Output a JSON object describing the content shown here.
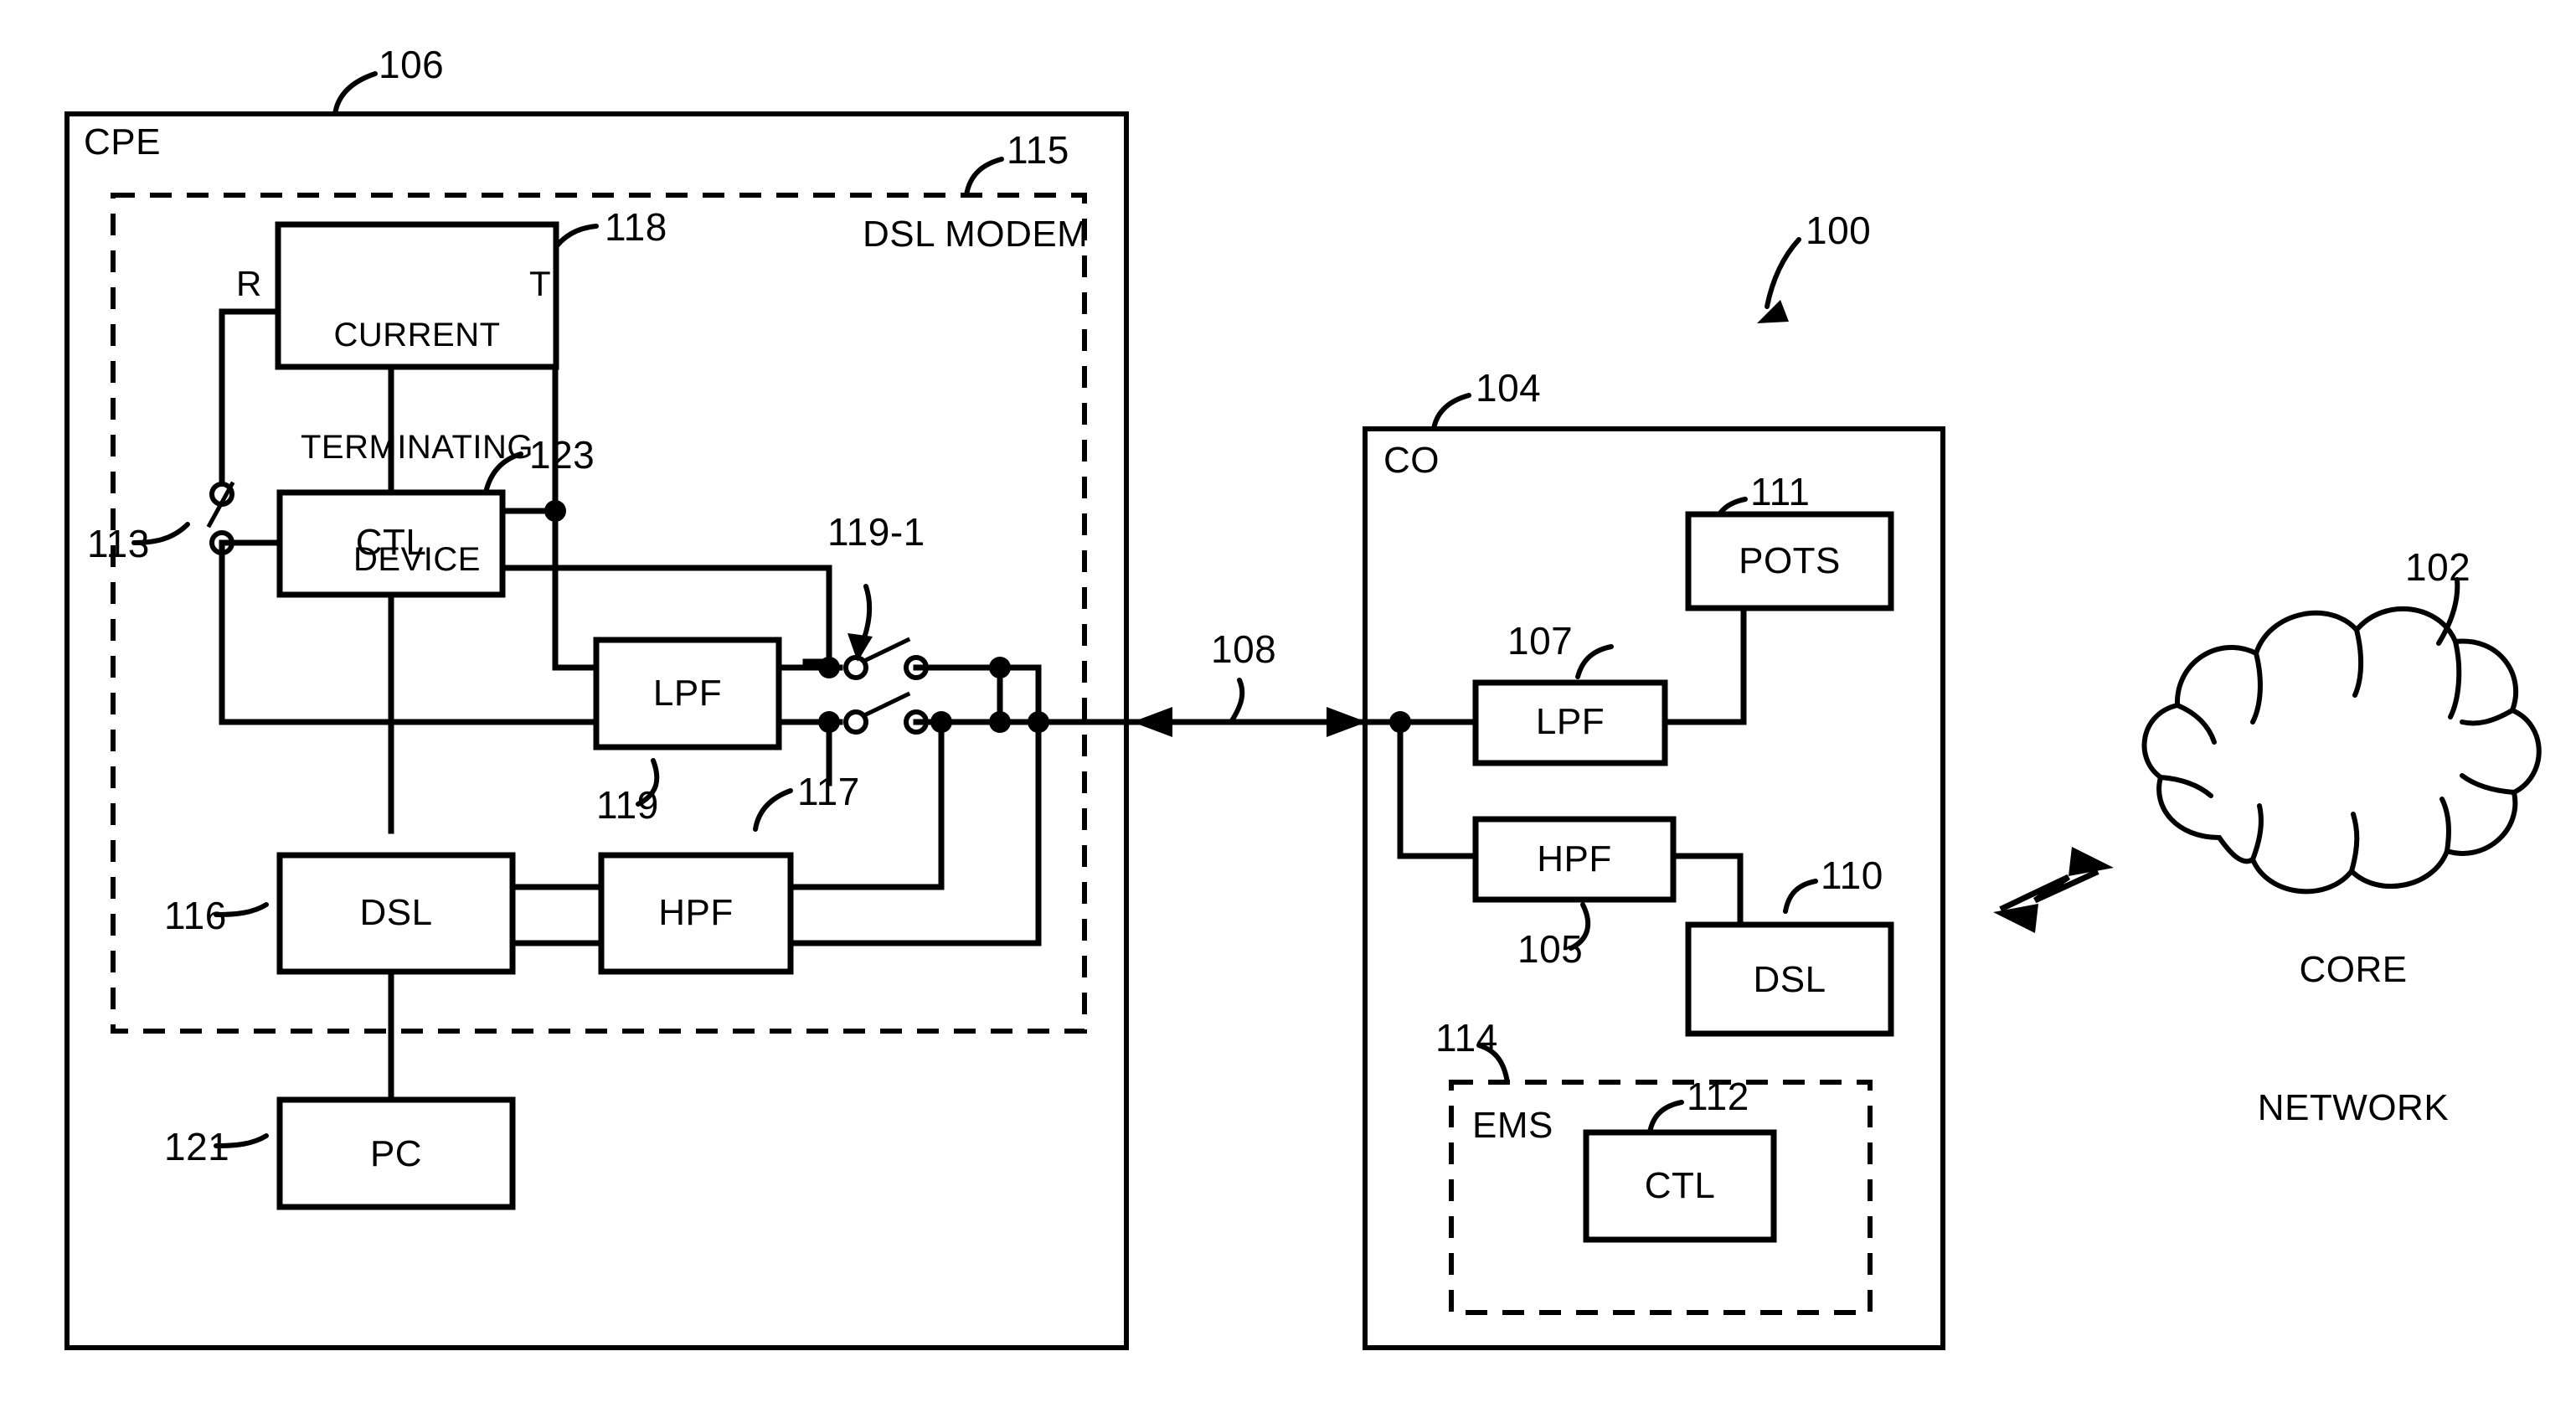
{
  "figure": {
    "type": "patent-block-diagram",
    "system_ref": "100"
  },
  "areas": {
    "cpe": {
      "label": "CPE",
      "ref": "106"
    },
    "dsl_modem": {
      "label": "DSL MODEM",
      "ref": "115"
    },
    "co": {
      "label": "CO",
      "ref": "104"
    },
    "ems": {
      "label": "EMS",
      "ref": "114"
    }
  },
  "blocks": {
    "current_terminating_device": {
      "label": "CURRENT\nTERMINATING\nDEVICE",
      "line1": "CURRENT",
      "line2": "TERMINATING",
      "line3": "DEVICE",
      "ref": "118"
    },
    "cpe_ctl": {
      "label": "CTL",
      "ref": "123"
    },
    "cpe_lpf": {
      "label": "LPF",
      "ref": "119"
    },
    "cpe_hpf": {
      "label": "HPF",
      "ref": "117"
    },
    "cpe_dsl": {
      "label": "DSL",
      "ref": "116"
    },
    "pc": {
      "label": "PC",
      "ref": "121"
    },
    "co_lpf": {
      "label": "LPF",
      "ref": "107"
    },
    "co_hpf": {
      "label": "HPF",
      "ref": "105"
    },
    "co_pots": {
      "label": "POTS",
      "ref": "111"
    },
    "co_dsl": {
      "label": "DSL",
      "ref": "110"
    },
    "ems_ctl": {
      "label": "CTL",
      "ref": "112"
    },
    "core_network": {
      "label": "CORE\nNETWORK",
      "line1": "CORE",
      "line2": "NETWORK",
      "ref": "102"
    }
  },
  "switches": {
    "line_switch": {
      "ref": "113"
    },
    "filter_switch": {
      "ref": "119-1"
    }
  },
  "links": {
    "subscriber_loop": {
      "ref": "108"
    }
  },
  "pins": {
    "ring": "R",
    "tip": "T"
  },
  "reference_numerals": [
    "100",
    "102",
    "104",
    "105",
    "106",
    "107",
    "108",
    "110",
    "111",
    "112",
    "113",
    "114",
    "115",
    "116",
    "117",
    "118",
    "119",
    "119-1",
    "121",
    "123"
  ],
  "colors": {
    "ink": "#000000",
    "background": "#ffffff"
  }
}
